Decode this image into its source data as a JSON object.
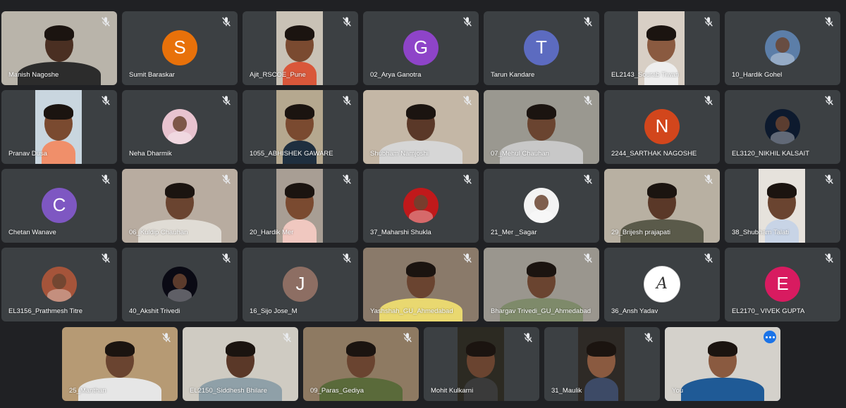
{
  "participants": [
    {
      "name": "Manish Nagoshe",
      "video": true,
      "bg": "#b9b4aa",
      "skin": "#4a2f22",
      "shirt": "#2c2c2c"
    },
    {
      "name": "Sumit Baraskar",
      "initial": "S",
      "color": "#e8710a"
    },
    {
      "name": "Ajit_RSCOE_Pune",
      "video": true,
      "bg": "#c9c2b6",
      "skin": "#7a4a30",
      "shirt": "#d9573a",
      "narrow": true
    },
    {
      "name": "02_Arya Ganotra",
      "initial": "G",
      "color": "#8e44c8"
    },
    {
      "name": "Tarun Kandare",
      "initial": "T",
      "color": "#5c6bc0"
    },
    {
      "name": "EL2143_Sourab Tiwari",
      "video": true,
      "bg": "#d8cfc5",
      "skin": "#8a5a40",
      "shirt": "#eeeeee",
      "narrow": true
    },
    {
      "name": "10_Hardik Gohel",
      "photo": true,
      "photoBg": "#5c7ea8"
    },
    {
      "name": "Pranav Dusa",
      "video": true,
      "bg": "#c9d6df",
      "skin": "#7a4a30",
      "shirt": "#f08f6a",
      "narrow": true,
      "mute": true
    },
    {
      "name": "Neha Dharmik",
      "photo": true,
      "photoBg": "#e8c3cf"
    },
    {
      "name": "1055_ABHISHEK GAWARE",
      "video": true,
      "bg": "#b5a88f",
      "skin": "#7a4a30",
      "shirt": "#1f2f3f",
      "narrow": true
    },
    {
      "name": "Shubham Namjoshi",
      "video": true,
      "bg": "#c4b7a6",
      "skin": "#5a3828",
      "shirt": "#d6d6d6"
    },
    {
      "name": "07_Mehul Chauhan",
      "video": true,
      "bg": "#9a9890",
      "skin": "#6a4430",
      "shirt": "#c8c8c8"
    },
    {
      "name": "2244_SARTHAK NAGOSHE",
      "initial": "N",
      "color": "#d2461c"
    },
    {
      "name": "EL3120_NIKHIL KALSAIT",
      "photo": true,
      "photoBg": "#0d1a2e"
    },
    {
      "name": "Chetan Wanave",
      "initial": "C",
      "color": "#7e57c2"
    },
    {
      "name": "06_Kuldip Chauhan",
      "video": true,
      "bg": "#b8aca0",
      "skin": "#6a4430",
      "shirt": "#e0dcd5"
    },
    {
      "name": "20_Hardik Mer",
      "video": true,
      "bg": "#a89e94",
      "skin": "#7a4a30",
      "shirt": "#f0c8c0",
      "narrow": true
    },
    {
      "name": "37_Maharshi Shukla",
      "photo": true,
      "photoBg": "#c0191b"
    },
    {
      "name": "21_Mer _Sagar",
      "photo": true,
      "photoBg": "#f3f3f3"
    },
    {
      "name": "29_Brijesh prajapati",
      "video": true,
      "bg": "#b8b0a2",
      "skin": "#5a3828",
      "shirt": "#5a5a4a"
    },
    {
      "name": "38_Shubham Talati",
      "video": true,
      "bg": "#e6e2dc",
      "skin": "#6a4430",
      "shirt": "#c8d4e6",
      "narrow": true
    },
    {
      "name": "EL3156_Prathmesh Titre",
      "photo": true,
      "photoBg": "#a5543a"
    },
    {
      "name": "40_Akshit Trivedi",
      "photo": true,
      "photoBg": "#0a0a14"
    },
    {
      "name": "16_Sijo Jose_M",
      "initial": "J",
      "color": "#8d6e63"
    },
    {
      "name": "Yashshah_GU_Ahmedabad",
      "video": true,
      "bg": "#8a7a6a",
      "skin": "#6a4430",
      "shirt": "#e9d870"
    },
    {
      "name": "Bhargav Trivedi_GU_Ahmedabad",
      "video": true,
      "bg": "#9a968e",
      "skin": "#6a4430",
      "shirt": "#7e8a6a"
    },
    {
      "name": "36_Ansh Yadav",
      "photo": true,
      "photoBg": "#ffffff",
      "sig": "A"
    },
    {
      "name": "EL2170_ VIVEK GUPTA",
      "initial": "E",
      "color": "#d81b60"
    },
    {
      "name": "25_Manthan",
      "video": true,
      "bg": "#b69a74",
      "skin": "#6a4430",
      "shirt": "#e6e6e6"
    },
    {
      "name": "EL2150_Siddhesh Bhilare",
      "video": true,
      "bg": "#cfcbc2",
      "skin": "#5a3828",
      "shirt": "#8fa0a8"
    },
    {
      "name": "09_Paras_Gediya",
      "video": true,
      "bg": "#8e7a62",
      "skin": "#6a4430",
      "shirt": "#5a6a3a"
    },
    {
      "name": "Mohit Kulkarni",
      "video": true,
      "bg": "#2c2a22",
      "skin": "#6a4430",
      "shirt": "#3a3a3a",
      "narrow": true
    },
    {
      "name": "31_Maulik",
      "video": true,
      "bg": "#2e2a26",
      "skin": "#8a5a40",
      "shirt": "#3d4a66",
      "narrow": true
    },
    {
      "name": "You",
      "video": true,
      "bg": "#d4d1cb",
      "skin": "#8a5a40",
      "shirt": "#1f5a96",
      "you": true
    }
  ],
  "colors": {
    "page": "#202124",
    "tile": "#3c4043",
    "accent": "#1a73e8"
  },
  "icons": {
    "mute": "mic-off-icon",
    "options": "more-options-icon"
  }
}
